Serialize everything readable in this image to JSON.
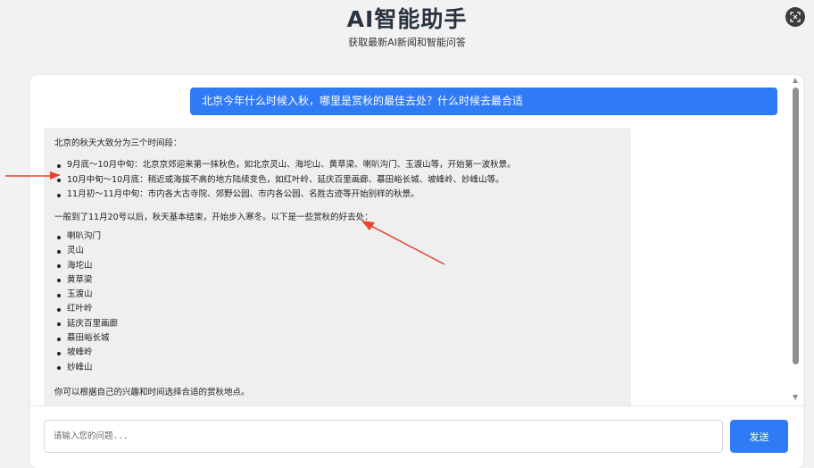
{
  "header": {
    "title": "AI智能助手",
    "subtitle": "获取最新AI新闻和智能问答",
    "corner_icon": "expand-icon"
  },
  "chat": {
    "user_message": "北京今年什么时候入秋，哪里是赏秋的最佳去处？什么时候去最合适",
    "ai_response": {
      "intro": "北京的秋天大致分为三个时间段：",
      "periods": [
        "9月底～10月中旬：北京京郊迎来第一抹秋色，如北京灵山、海坨山、黄草梁、喇叭沟门、玉渡山等，开始第一波秋景。",
        "10月中旬～10月底：稍近或海拔不高的地方陆续变色，如红叶岭、延庆百里画廊、慕田峪长城、坡峰岭、妙峰山等。",
        "11月初～11月中旬：市内各大古寺院、郊野公园、市内各公园、名胜古迹等开始别样的秋景。"
      ],
      "transition": "一般到了11月20号以后，秋天基本结束，开始步入寒冬。以下是一些赏秋的好去处：",
      "places": [
        "喇叭沟门",
        "灵山",
        "海坨山",
        "黄草梁",
        "玉渡山",
        "红叶岭",
        "延庆百里画廊",
        "慕田峪长城",
        "坡峰岭",
        "妙峰山"
      ],
      "closing": "你可以根据自己的兴趣和时间选择合适的赏秋地点。"
    }
  },
  "input": {
    "placeholder": "请输入您的问题...",
    "send_label": "发送"
  },
  "colors": {
    "accent": "#2f7bf6",
    "annotation": "#e8412c",
    "ai_bubble": "#efefef"
  }
}
